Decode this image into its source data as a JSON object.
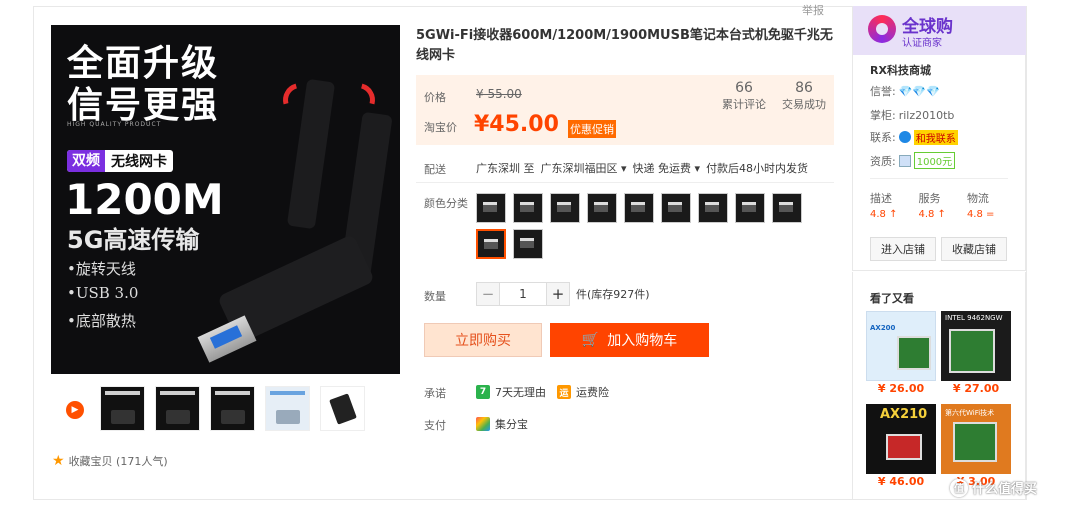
{
  "report": "举报",
  "gallery": {
    "headline1": "全面升级",
    "headline2": "信号更强",
    "tagline": "HIGH QUALITY PRODUCT",
    "badge_left": "双频",
    "badge_right": "无线网卡",
    "big": "1200M",
    "speed": "5G高速传输",
    "features": [
      "•旋转天线",
      "•USB 3.0",
      "•底部散热"
    ],
    "favorite": "收藏宝贝 (171人气)"
  },
  "product": {
    "title": "5GWi-Fi接收器600M/1200M/1900MUSB笔记本台式机免驱千兆无线网卡",
    "price_label": "价格",
    "original_price": "¥ 55.00",
    "promo_label": "淘宝价",
    "current_price": "¥45.00",
    "promo_tag": "优惠促销",
    "reviews_count": "66",
    "reviews_label": "累计评论",
    "sold_count": "86",
    "sold_label": "交易成功",
    "ship_label": "配送",
    "ship_from": "广东深圳 至",
    "ship_to": "广东深圳福田区",
    "ship_method": "快递 免运费",
    "ship_time": "付款后48小时内发货",
    "color_label": "颜色分类",
    "qty_label": "数量",
    "qty_value": "1",
    "stock": "件(库存927件)",
    "buy_now": "立即购买",
    "add_cart": "加入购物车",
    "promise_label": "承诺",
    "promise_1": "7天无理由",
    "promise_2": "运费险",
    "pay_label": "支付",
    "pay_1": "集分宝"
  },
  "shop": {
    "brand": "全球购",
    "brand_sub": "认证商家",
    "name": "RX科技商城",
    "credit_label": "信誉:",
    "keeper_label": "掌柜:",
    "keeper": "rilz2010tb",
    "contact_label": "联系:",
    "contact": "和我联系",
    "qual_label": "资质:",
    "deposit": "1000元",
    "scores": [
      {
        "k": "描述",
        "v": "4.8 ↑"
      },
      {
        "k": "服务",
        "v": "4.8 ↑"
      },
      {
        "k": "物流",
        "v": "4.8 ="
      }
    ],
    "enter": "进入店铺",
    "collect": "收藏店铺"
  },
  "also": {
    "title": "看了又看",
    "items": [
      {
        "price": "¥ 26.00",
        "label": "AX200"
      },
      {
        "price": "¥ 27.00",
        "label": "INTEL 9462NGW"
      },
      {
        "price": "¥ 46.00",
        "label": "AX210"
      },
      {
        "price": "¥ 3.00",
        "label": "第六代WiFi技术"
      }
    ]
  },
  "watermark": "什么值得买",
  "colors": {
    "accent": "#ff4400",
    "promo_bg": "#fff2e8",
    "brand": "#6a33cc"
  }
}
